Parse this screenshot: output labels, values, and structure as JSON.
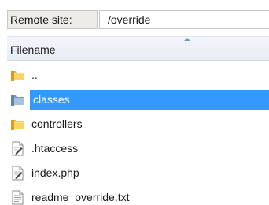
{
  "remote_site": {
    "label": "Remote site:",
    "path": "/override"
  },
  "file_list": {
    "column_header": "Filename",
    "sort_direction": "ascending",
    "selection_color": "#3399ff",
    "items": [
      {
        "name": "..",
        "icon": "folder-icon",
        "type": "folder",
        "selected": false
      },
      {
        "name": "classes",
        "icon": "folder-icon",
        "type": "folder",
        "selected": true
      },
      {
        "name": "controllers",
        "icon": "folder-icon",
        "type": "folder",
        "selected": false
      },
      {
        "name": ".htaccess",
        "icon": "file-edit-icon",
        "type": "file",
        "selected": false
      },
      {
        "name": "index.php",
        "icon": "file-edit-icon",
        "type": "file",
        "selected": false
      },
      {
        "name": "readme_override.txt",
        "icon": "text-file-icon",
        "type": "file",
        "selected": false
      }
    ]
  }
}
